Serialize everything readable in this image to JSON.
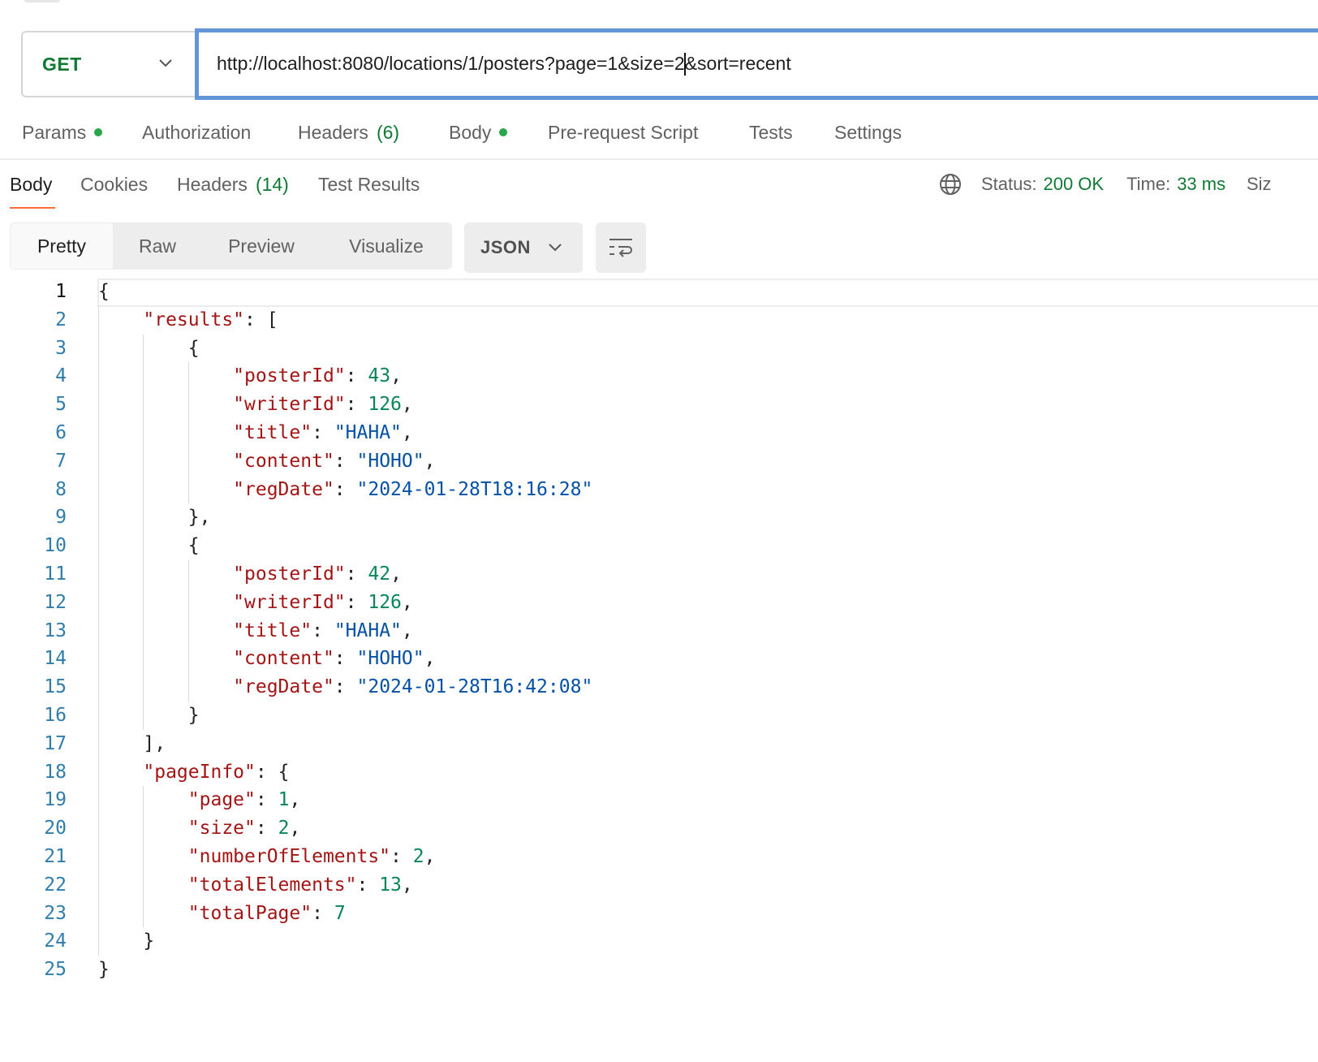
{
  "request": {
    "method": "GET",
    "url_before_caret": "http://localhost:8080/locations/1/posters?page=1&size=2",
    "url_after_caret": "&sort=recent"
  },
  "request_tabs": [
    {
      "label": "Params",
      "dot": true
    },
    {
      "label": "Authorization"
    },
    {
      "label": "Headers",
      "count": "(6)"
    },
    {
      "label": "Body",
      "dot": true
    },
    {
      "label": "Pre-request Script"
    },
    {
      "label": "Tests"
    },
    {
      "label": "Settings"
    }
  ],
  "response_tabs": [
    {
      "label": "Body",
      "active": true
    },
    {
      "label": "Cookies"
    },
    {
      "label": "Headers",
      "count": "(14)"
    },
    {
      "label": "Test Results"
    }
  ],
  "response_meta": {
    "status_label": "Status:",
    "status_value": "200 OK",
    "time_label": "Time:",
    "time_value": "33 ms",
    "size_label_clipped": "Siz"
  },
  "view_modes": [
    "Pretty",
    "Raw",
    "Preview",
    "Visualize"
  ],
  "active_view_mode": "Pretty",
  "format": "JSON",
  "icons": {
    "method_chevron": "chevron-down-icon",
    "globe": "globe-icon",
    "format_chevron": "chevron-down-icon",
    "wrap": "wrap-lines-icon"
  },
  "colors": {
    "accent": "#ff6c37",
    "status_green": "#0f7a34",
    "url_focus_border": "#6494d8",
    "json_key": "#a31515",
    "json_string": "#0451a5",
    "json_number": "#098658",
    "line_number": "#2e7dab"
  },
  "code": {
    "line_numbers": [
      "1",
      "2",
      "3",
      "4",
      "5",
      "6",
      "7",
      "8",
      "9",
      "10",
      "11",
      "12",
      "13",
      "14",
      "15",
      "16",
      "17",
      "18",
      "19",
      "20",
      "21",
      "22",
      "23",
      "24",
      "25"
    ],
    "lines": [
      [
        {
          "t": "{",
          "c": "p"
        }
      ],
      [
        {
          "t": "    ",
          "c": "p"
        },
        {
          "t": "\"results\"",
          "c": "k"
        },
        {
          "t": ": [",
          "c": "p"
        }
      ],
      [
        {
          "t": "        {",
          "c": "p"
        }
      ],
      [
        {
          "t": "            ",
          "c": "p"
        },
        {
          "t": "\"posterId\"",
          "c": "k"
        },
        {
          "t": ": ",
          "c": "p"
        },
        {
          "t": "43",
          "c": "n"
        },
        {
          "t": ",",
          "c": "p"
        }
      ],
      [
        {
          "t": "            ",
          "c": "p"
        },
        {
          "t": "\"writerId\"",
          "c": "k"
        },
        {
          "t": ": ",
          "c": "p"
        },
        {
          "t": "126",
          "c": "n"
        },
        {
          "t": ",",
          "c": "p"
        }
      ],
      [
        {
          "t": "            ",
          "c": "p"
        },
        {
          "t": "\"title\"",
          "c": "k"
        },
        {
          "t": ": ",
          "c": "p"
        },
        {
          "t": "\"HAHA\"",
          "c": "s"
        },
        {
          "t": ",",
          "c": "p"
        }
      ],
      [
        {
          "t": "            ",
          "c": "p"
        },
        {
          "t": "\"content\"",
          "c": "k"
        },
        {
          "t": ": ",
          "c": "p"
        },
        {
          "t": "\"HOHO\"",
          "c": "s"
        },
        {
          "t": ",",
          "c": "p"
        }
      ],
      [
        {
          "t": "            ",
          "c": "p"
        },
        {
          "t": "\"regDate\"",
          "c": "k"
        },
        {
          "t": ": ",
          "c": "p"
        },
        {
          "t": "\"2024-01-28T18:16:28\"",
          "c": "s"
        }
      ],
      [
        {
          "t": "        },",
          "c": "p"
        }
      ],
      [
        {
          "t": "        {",
          "c": "p"
        }
      ],
      [
        {
          "t": "            ",
          "c": "p"
        },
        {
          "t": "\"posterId\"",
          "c": "k"
        },
        {
          "t": ": ",
          "c": "p"
        },
        {
          "t": "42",
          "c": "n"
        },
        {
          "t": ",",
          "c": "p"
        }
      ],
      [
        {
          "t": "            ",
          "c": "p"
        },
        {
          "t": "\"writerId\"",
          "c": "k"
        },
        {
          "t": ": ",
          "c": "p"
        },
        {
          "t": "126",
          "c": "n"
        },
        {
          "t": ",",
          "c": "p"
        }
      ],
      [
        {
          "t": "            ",
          "c": "p"
        },
        {
          "t": "\"title\"",
          "c": "k"
        },
        {
          "t": ": ",
          "c": "p"
        },
        {
          "t": "\"HAHA\"",
          "c": "s"
        },
        {
          "t": ",",
          "c": "p"
        }
      ],
      [
        {
          "t": "            ",
          "c": "p"
        },
        {
          "t": "\"content\"",
          "c": "k"
        },
        {
          "t": ": ",
          "c": "p"
        },
        {
          "t": "\"HOHO\"",
          "c": "s"
        },
        {
          "t": ",",
          "c": "p"
        }
      ],
      [
        {
          "t": "            ",
          "c": "p"
        },
        {
          "t": "\"regDate\"",
          "c": "k"
        },
        {
          "t": ": ",
          "c": "p"
        },
        {
          "t": "\"2024-01-28T16:42:08\"",
          "c": "s"
        }
      ],
      [
        {
          "t": "        }",
          "c": "p"
        }
      ],
      [
        {
          "t": "    ],",
          "c": "p"
        }
      ],
      [
        {
          "t": "    ",
          "c": "p"
        },
        {
          "t": "\"pageInfo\"",
          "c": "k"
        },
        {
          "t": ": {",
          "c": "p"
        }
      ],
      [
        {
          "t": "        ",
          "c": "p"
        },
        {
          "t": "\"page\"",
          "c": "k"
        },
        {
          "t": ": ",
          "c": "p"
        },
        {
          "t": "1",
          "c": "n"
        },
        {
          "t": ",",
          "c": "p"
        }
      ],
      [
        {
          "t": "        ",
          "c": "p"
        },
        {
          "t": "\"size\"",
          "c": "k"
        },
        {
          "t": ": ",
          "c": "p"
        },
        {
          "t": "2",
          "c": "n"
        },
        {
          "t": ",",
          "c": "p"
        }
      ],
      [
        {
          "t": "        ",
          "c": "p"
        },
        {
          "t": "\"numberOfElements\"",
          "c": "k"
        },
        {
          "t": ": ",
          "c": "p"
        },
        {
          "t": "2",
          "c": "n"
        },
        {
          "t": ",",
          "c": "p"
        }
      ],
      [
        {
          "t": "        ",
          "c": "p"
        },
        {
          "t": "\"totalElements\"",
          "c": "k"
        },
        {
          "t": ": ",
          "c": "p"
        },
        {
          "t": "13",
          "c": "n"
        },
        {
          "t": ",",
          "c": "p"
        }
      ],
      [
        {
          "t": "        ",
          "c": "p"
        },
        {
          "t": "\"totalPage\"",
          "c": "k"
        },
        {
          "t": ": ",
          "c": "p"
        },
        {
          "t": "7",
          "c": "n"
        }
      ],
      [
        {
          "t": "    }",
          "c": "p"
        }
      ],
      [
        {
          "t": "}",
          "c": "p"
        }
      ]
    ]
  }
}
